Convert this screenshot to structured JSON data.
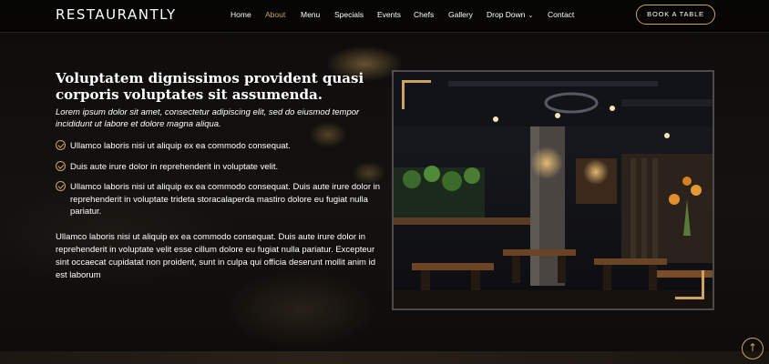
{
  "header": {
    "logo": "RESTAURANTLY",
    "nav": [
      {
        "label": "Home",
        "active": false
      },
      {
        "label": "About",
        "active": true
      },
      {
        "label": "Menu",
        "active": false
      },
      {
        "label": "Specials",
        "active": false
      },
      {
        "label": "Events",
        "active": false
      },
      {
        "label": "Chefs",
        "active": false
      },
      {
        "label": "Gallery",
        "active": false
      },
      {
        "label": "Drop Down",
        "active": false
      },
      {
        "label": "Contact",
        "active": false
      }
    ],
    "book_button": "BOOK A TABLE"
  },
  "about": {
    "title": "Voluptatem dignissimos provident quasi corporis voluptates sit assumenda.",
    "lead": "Lorem ipsum dolor sit amet, consectetur adipiscing elit, sed do eiusmod tempor incididunt ut labore et dolore magna aliqua.",
    "list": [
      "Ullamco laboris nisi ut aliquip ex ea commodo consequat.",
      "Duis aute irure dolor in reprehenderit in voluptate velit.",
      "Ullamco laboris nisi ut aliquip ex ea commodo consequat. Duis aute irure dolor in reprehenderit in voluptate trideta storacalaperda mastiro dolore eu fugiat nulla pariatur."
    ],
    "paragraph": "Ullamco laboris nisi ut aliquip ex ea commodo consequat. Duis aute irure dolor in reprehenderit in voluptate velit esse cillum dolore eu fugiat nulla pariatur. Excepteur sint occaecat cupidatat non proident, sunt in culpa qui officia deserunt mollit anim id est laborum"
  },
  "icons": {
    "check": "check-circle-icon",
    "dropdown": "chevron-down-icon",
    "back_to_top": "arrow-up-icon"
  },
  "colors": {
    "accent": "#cda45e",
    "background": "#0c0b0a",
    "text": "#ffffff"
  }
}
